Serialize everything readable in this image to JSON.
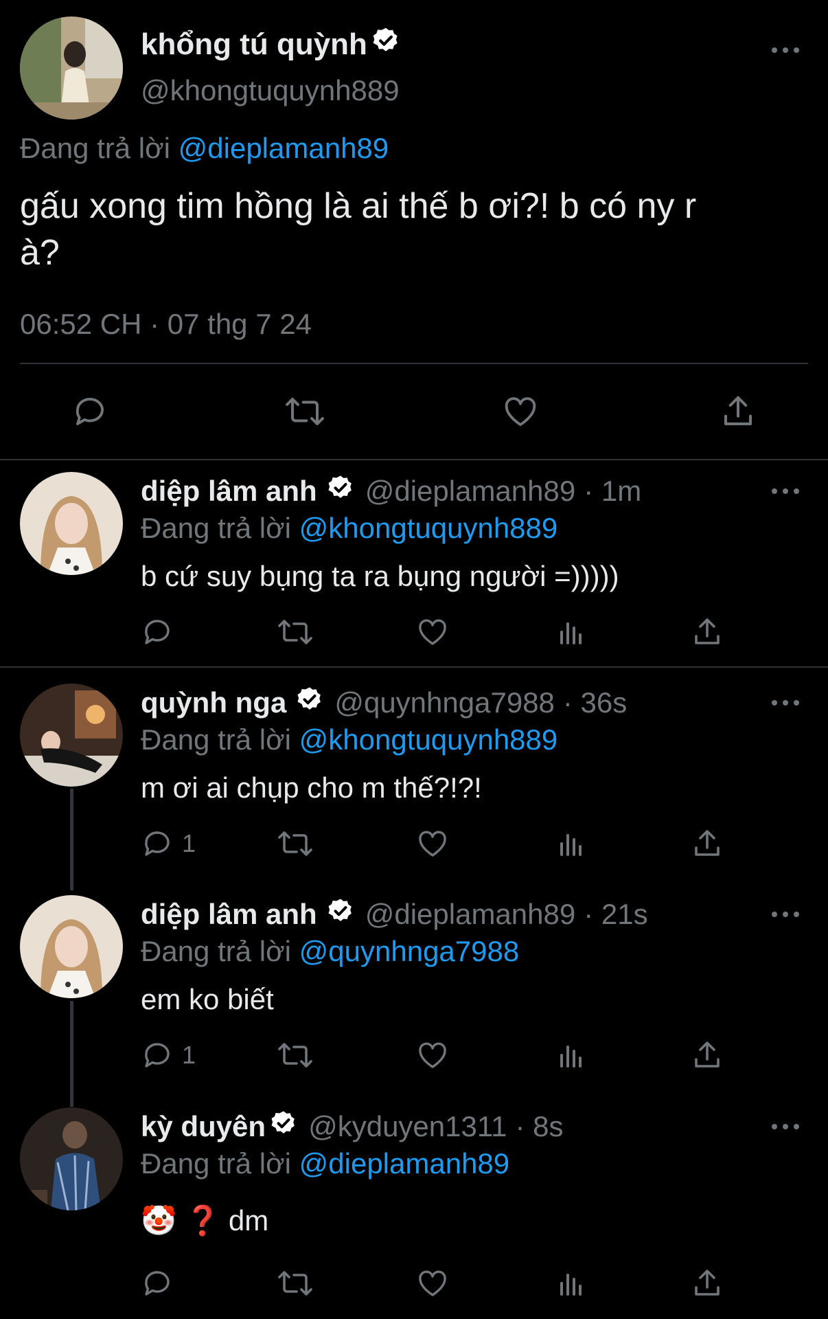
{
  "main_tweet": {
    "display_name": "khổng tú quỳnh",
    "handle": "@khongtuquynh889",
    "replying_prefix": "Đang trả lời",
    "replying_to": "@dieplamanh89",
    "text_line1": "gấu xong tim hồng là ai thế b ơi?! b có ny r",
    "text_line2": "à?",
    "timestamp": "06:52 CH · 07 thg 7 24"
  },
  "replies": [
    {
      "display_name": "diệp lâm anh",
      "handle": "@dieplamanh89",
      "time": "· 1m",
      "replying_prefix": "Đang trả lời",
      "replying_to": "@khongtuquynh889",
      "text": "b cứ suy bụng ta ra bụng người =)))))",
      "reply_count": ""
    },
    {
      "display_name": "quỳnh nga",
      "handle": "@quynhnga7988",
      "time": "· 36s",
      "replying_prefix": "Đang trả lời",
      "replying_to": "@khongtuquynh889",
      "text": "m ơi ai chụp cho m thế?!?!",
      "reply_count": "1"
    },
    {
      "display_name": "diệp lâm anh",
      "handle": "@dieplamanh89",
      "time": "· 21s",
      "replying_prefix": "Đang trả lời",
      "replying_to": "@quynhnga7988",
      "text": "em ko biết",
      "reply_count": "1"
    },
    {
      "display_name": "kỳ duyên",
      "handle": "@kyduyen1311",
      "time": "· 8s",
      "replying_prefix": "Đang trả lời",
      "replying_to": "@dieplamanh89",
      "text": "🤡 ❓ dm",
      "reply_count": ""
    }
  ],
  "colors": {
    "background": "#000000",
    "text": "#e7e9ea",
    "muted": "#71767b",
    "link": "#1d9bf0"
  },
  "icons": [
    "reply-icon",
    "retweet-icon",
    "like-icon",
    "views-icon",
    "share-icon",
    "verified-icon",
    "more-icon"
  ]
}
